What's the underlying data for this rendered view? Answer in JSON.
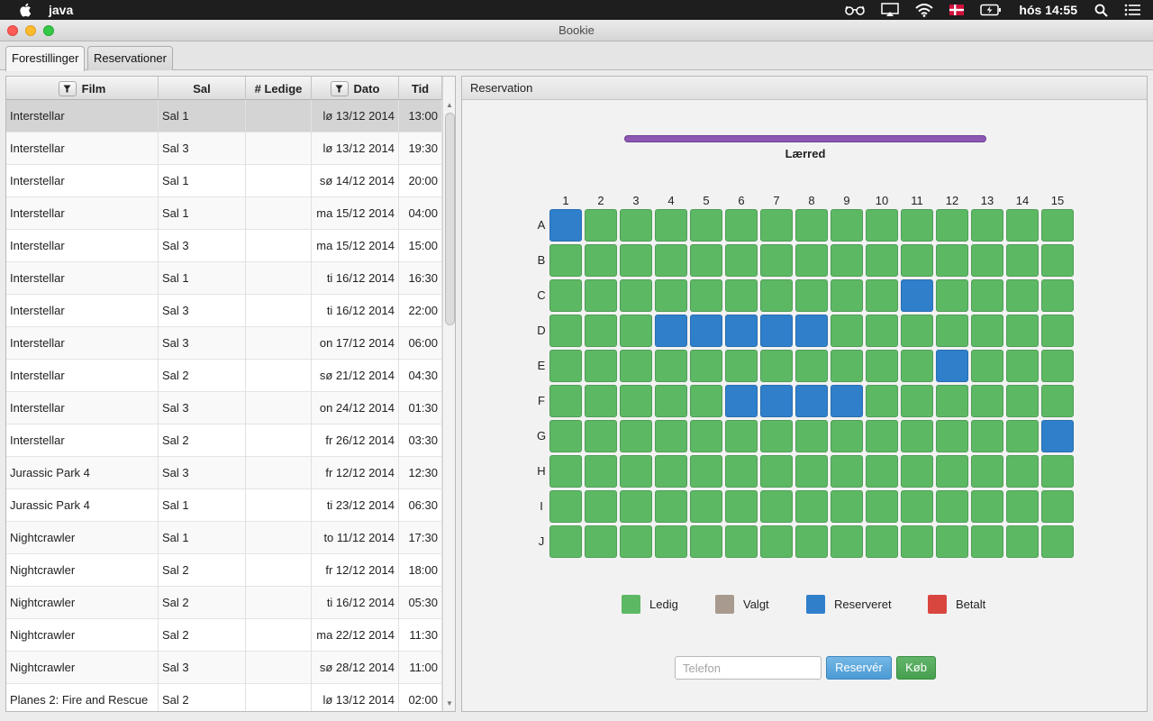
{
  "menubar": {
    "app_name": "java",
    "flag_alt": "DK",
    "clock": "hós 14:55"
  },
  "window": {
    "title": "Bookie"
  },
  "tabs": [
    {
      "label": "Forestillinger",
      "active": true
    },
    {
      "label": "Reservationer",
      "active": false
    }
  ],
  "table": {
    "columns": [
      {
        "label": "Film",
        "filter": true
      },
      {
        "label": "Sal",
        "filter": false
      },
      {
        "label": "# Ledige",
        "filter": false
      },
      {
        "label": "Dato",
        "filter": true
      },
      {
        "label": "Tid",
        "filter": false
      }
    ],
    "rows": [
      {
        "film": "Interstellar",
        "sal": "Sal 1",
        "ledige": "",
        "dato": "lø 13/12 2014",
        "tid": "13:00",
        "selected": true
      },
      {
        "film": "Interstellar",
        "sal": "Sal 3",
        "ledige": "",
        "dato": "lø 13/12 2014",
        "tid": "19:30"
      },
      {
        "film": "Interstellar",
        "sal": "Sal 1",
        "ledige": "",
        "dato": "sø 14/12 2014",
        "tid": "20:00"
      },
      {
        "film": "Interstellar",
        "sal": "Sal 1",
        "ledige": "",
        "dato": "ma 15/12 2014",
        "tid": "04:00"
      },
      {
        "film": "Interstellar",
        "sal": "Sal 3",
        "ledige": "",
        "dato": "ma 15/12 2014",
        "tid": "15:00"
      },
      {
        "film": "Interstellar",
        "sal": "Sal 1",
        "ledige": "",
        "dato": "ti 16/12 2014",
        "tid": "16:30"
      },
      {
        "film": "Interstellar",
        "sal": "Sal 3",
        "ledige": "",
        "dato": "ti 16/12 2014",
        "tid": "22:00"
      },
      {
        "film": "Interstellar",
        "sal": "Sal 3",
        "ledige": "",
        "dato": "on 17/12 2014",
        "tid": "06:00"
      },
      {
        "film": "Interstellar",
        "sal": "Sal 2",
        "ledige": "",
        "dato": "sø 21/12 2014",
        "tid": "04:30"
      },
      {
        "film": "Interstellar",
        "sal": "Sal 3",
        "ledige": "",
        "dato": "on 24/12 2014",
        "tid": "01:30"
      },
      {
        "film": "Interstellar",
        "sal": "Sal 2",
        "ledige": "",
        "dato": "fr 26/12 2014",
        "tid": "03:30"
      },
      {
        "film": "Jurassic Park 4",
        "sal": "Sal 3",
        "ledige": "",
        "dato": "fr 12/12 2014",
        "tid": "12:30"
      },
      {
        "film": "Jurassic Park 4",
        "sal": "Sal 1",
        "ledige": "",
        "dato": "ti 23/12 2014",
        "tid": "06:30"
      },
      {
        "film": "Nightcrawler",
        "sal": "Sal 1",
        "ledige": "",
        "dato": "to 11/12 2014",
        "tid": "17:30"
      },
      {
        "film": "Nightcrawler",
        "sal": "Sal 2",
        "ledige": "",
        "dato": "fr 12/12 2014",
        "tid": "18:00"
      },
      {
        "film": "Nightcrawler",
        "sal": "Sal 2",
        "ledige": "",
        "dato": "ti 16/12 2014",
        "tid": "05:30"
      },
      {
        "film": "Nightcrawler",
        "sal": "Sal 2",
        "ledige": "",
        "dato": "ma 22/12 2014",
        "tid": "11:30"
      },
      {
        "film": "Nightcrawler",
        "sal": "Sal 3",
        "ledige": "",
        "dato": "sø 28/12 2014",
        "tid": "11:00"
      },
      {
        "film": "Planes 2: Fire and Rescue",
        "sal": "Sal 2",
        "ledige": "",
        "dato": "lø 13/12 2014",
        "tid": "02:00"
      }
    ]
  },
  "reservation": {
    "header": "Reservation",
    "screen_label": "Lærred",
    "column_labels": [
      "1",
      "2",
      "3",
      "4",
      "5",
      "6",
      "7",
      "8",
      "9",
      "10",
      "11",
      "12",
      "13",
      "14",
      "15"
    ],
    "row_labels": [
      "A",
      "B",
      "C",
      "D",
      "E",
      "F",
      "G",
      "H",
      "I",
      "J"
    ],
    "reserved_seats": [
      "A1",
      "C11",
      "D4",
      "D5",
      "D6",
      "D7",
      "D8",
      "E12",
      "F6",
      "F7",
      "F8",
      "F9",
      "G15"
    ],
    "legend": [
      {
        "label": "Ledig",
        "color": "#5db864"
      },
      {
        "label": "Valgt",
        "color": "#a89a8e"
      },
      {
        "label": "Reserveret",
        "color": "#2f7fcb"
      },
      {
        "label": "Betalt",
        "color": "#d9463f"
      }
    ],
    "phone_placeholder": "Telefon",
    "reserve_button": "Reservér",
    "buy_button": "Køb"
  }
}
